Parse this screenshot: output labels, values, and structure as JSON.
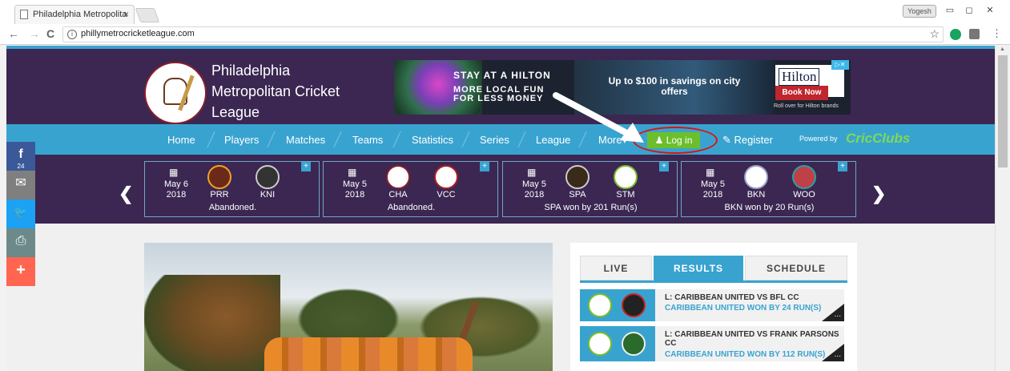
{
  "browser": {
    "tab_title": "Philadelphia Metropolita",
    "tab_close": "×",
    "user_badge": "Yogesh",
    "url": "phillymetrocricketleague.com",
    "nav": {
      "back": "←",
      "forward": "→",
      "reload": "C",
      "star": "☆",
      "menu": "⋮",
      "info": "i"
    },
    "window": {
      "minimize": "▭",
      "maximize": "◻",
      "close": "✕"
    }
  },
  "site": {
    "title": "Philadelphia Metropolitan Cricket League",
    "ad": {
      "tagline": "STAY AT A HILTON",
      "tagline2": "MORE LOCAL FUN FOR LESS MONEY",
      "offer": "Up to $100 in savings on city offers",
      "brand": "Hilton",
      "cta": "Book Now",
      "fine_print": "Roll over for Hilton brands",
      "adchoices": "▷✕"
    },
    "nav": {
      "items": [
        "Home",
        "Players",
        "Matches",
        "Teams",
        "Statistics",
        "Series",
        "League",
        "More▾"
      ],
      "login": "Log in",
      "login_icon": "user-icon",
      "register": "Register",
      "register_icon": "edit-icon",
      "powered_by": "Powered by",
      "brand": "CricClubs"
    },
    "scores": [
      {
        "date_day": "May 6",
        "date_year": "2018",
        "team1": "PRR",
        "team2": "KNI",
        "result": "Abandoned."
      },
      {
        "date_day": "May 5",
        "date_year": "2018",
        "team1": "CHA",
        "team2": "VCC",
        "result": "Abandoned."
      },
      {
        "date_day": "May 5",
        "date_year": "2018",
        "team1": "SPA",
        "team2": "STM",
        "result": "SPA won by 201 Run(s)"
      },
      {
        "date_day": "May 5",
        "date_year": "2018",
        "team1": "BKN",
        "team2": "WOO",
        "result": "BKN won by 20 Run(s)"
      }
    ],
    "share": {
      "facebook": "f",
      "facebook_count": "24",
      "email": "✉",
      "twitter": "🐦",
      "print": "⎙",
      "more": "+"
    },
    "panel": {
      "tabs": [
        "LIVE",
        "RESULTS",
        "SCHEDULE"
      ],
      "active_tab": "RESULTS",
      "matches": [
        {
          "name": "L: CARIBBEAN UNITED VS BFL CC",
          "result": "CARIBBEAN UNITED WON BY 24 RUN(S)"
        },
        {
          "name": "L: CARIBBEAN UNITED VS FRANK PARSONS CC",
          "result": "CARIBBEAN UNITED WON BY 112 RUN(S)"
        }
      ],
      "more": "..."
    },
    "colors": {
      "header_purple": "#3b2752",
      "nav_blue": "#39a3d0",
      "login_green": "#6bbf2c",
      "annotation_red": "#dd1111"
    }
  }
}
